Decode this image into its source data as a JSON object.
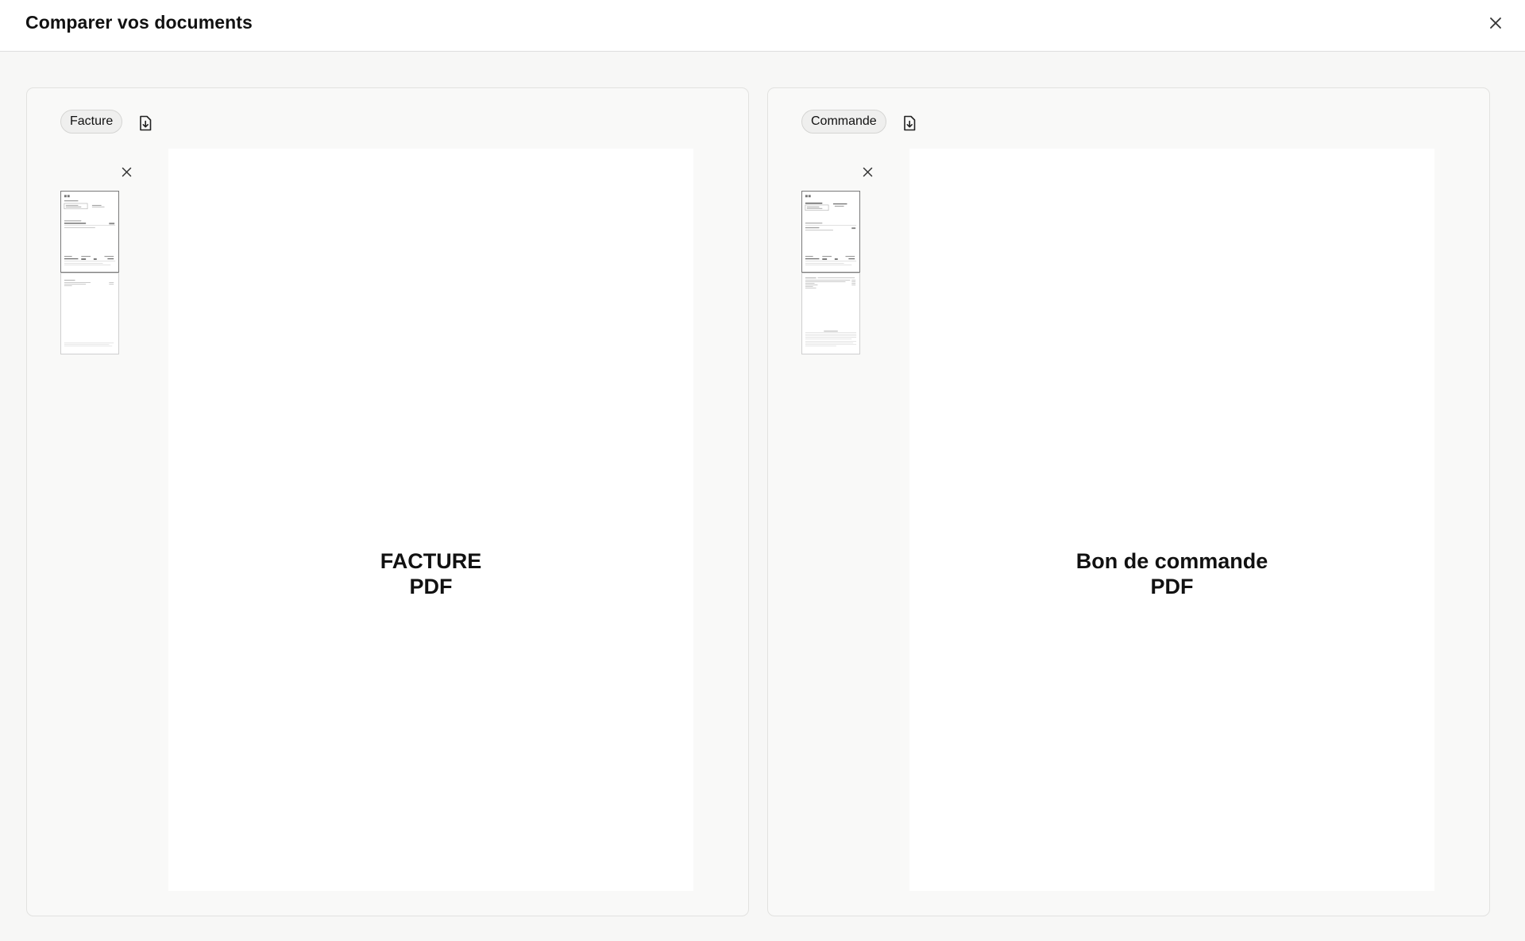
{
  "dialog": {
    "title": "Comparer vos documents",
    "close_icon": "close-icon"
  },
  "panels": [
    {
      "tag": "Facture",
      "download_icon": "file-download-icon",
      "viewer_line1": "FACTURE",
      "viewer_line2": "PDF",
      "pages": 2,
      "selected_page": 1
    },
    {
      "tag": "Commande",
      "download_icon": "file-download-icon",
      "viewer_line1": "Bon de commande",
      "viewer_line2": "PDF",
      "pages": 2,
      "selected_page": 1
    }
  ]
}
